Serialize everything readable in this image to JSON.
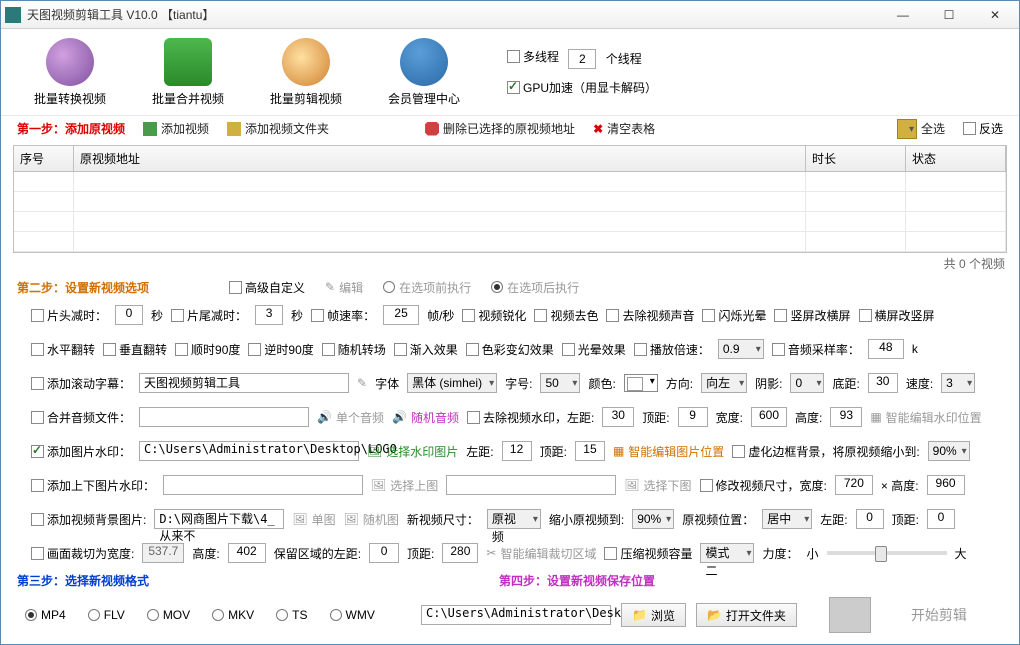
{
  "title": "天图视频剪辑工具 V10.0 【tiantu】",
  "win": {
    "min": "—",
    "max": "☐",
    "close": "✕"
  },
  "toolbar": {
    "t1": "批量转换视频",
    "t2": "批量合并视频",
    "t3": "批量剪辑视频",
    "t4": "会员管理中心",
    "multi": "多线程",
    "threads": "2",
    "threadsuf": "个线程",
    "gpu": "GPU加速（用显卡解码）"
  },
  "s1": {
    "title": "第一步：添加原视频",
    "add": "添加视频",
    "addf": "添加视频文件夹",
    "del": "删除已选择的原视频地址",
    "clear": "清空表格",
    "selall": "全选",
    "invsel": "反选"
  },
  "table": {
    "c1": "序号",
    "c2": "原视频地址",
    "c3": "时长",
    "c4": "状态"
  },
  "count": "共 0 个视频",
  "s2": {
    "title": "第二步：设置新视频选项",
    "adv": "高级自定义",
    "edit": "编辑",
    "before": "在选项前执行",
    "after": "在选项后执行"
  },
  "o": {
    "head": "片头减时：",
    "headv": "0",
    "sec": "秒",
    "tail": "片尾减时：",
    "tailv": "3",
    "fps": "帧速率：",
    "fpsv": "25",
    "fpsu": "帧/秒",
    "sharp": "视频锐化",
    "gray": "视频去色",
    "mute": "去除视频声音",
    "flash": "闪烁光晕",
    "v2h": "竖屏改横屏",
    "h2v": "横屏改竖屏",
    "hflip": "水平翻转",
    "vflip": "垂直翻转",
    "cw90": "顺时90度",
    "ccw90": "逆时90度",
    "rtrans": "随机转场",
    "fadein": "渐入效果",
    "colorfx": "色彩变幻效果",
    "halo": "光晕效果",
    "speed": "播放倍速：",
    "speedv": "0.9",
    "asr": "音频采样率：",
    "asrv": "48",
    "asru": "k",
    "subt": "添加滚动字幕：",
    "subtv": "天图视频剪辑工具",
    "font": "字体",
    "fontv": "黑体 (simhei)",
    "size": "字号:",
    "sizev": "50",
    "color": "颜色:",
    "dir": "方向:",
    "dirv": "向左",
    "shadow": "阴影:",
    "shadowv": "0",
    "bottom": "底距:",
    "bottomv": "30",
    "subspeed": "速度:",
    "subspeedv": "3",
    "mergea": "合并音频文件：",
    "singlea": "单个音频",
    "randa": "随机音频",
    "rmwm": "去除视频水印，左距:",
    "rmwmlv": "30",
    "top": "顶距:",
    "rmwmtv": "9",
    "w": "宽度:",
    "rmwmwv": "600",
    "h": "高度:",
    "rmwmhv": "93",
    "smartwm": "智能编辑水印位置",
    "addimg": "添加图片水印：",
    "addimgv": "C:\\Users\\Administrator\\Desktop\\LOGO",
    "selimg": "选择水印图片",
    "imglv": "12",
    "imgtv": "15",
    "smartimg": "智能编辑图片位置",
    "blur": "虚化边框背景，将原视频缩小到:",
    "blurv": "90%",
    "addtb": "添加上下图片水印：",
    "seltop": "选择上图",
    "selbot": "选择下图",
    "resize": "修改视频尺寸，宽度:",
    "rw": "720",
    "x": "× 高度:",
    "rh": "960",
    "bgimg": "添加视频背景图片:",
    "bgimgv": "D:\\网商图片下载\\4_从来不",
    "single": "单图",
    "rand": "随机图",
    "newsize": "新视频尺寸：",
    "newsizev": "原视频",
    "shrink": "缩小原视频到:",
    "shrinkv": "90%",
    "pos": "原视频位置：",
    "posv": "居中",
    "left": "左距:",
    "leftv": "0",
    "topv": "0",
    "crop": "画面裁切为宽度:",
    "cropwv": "537.7",
    "crophv": "402",
    "keepl": "保留区域的左距:",
    "keeplv": "0",
    "keeptv": "280",
    "smartcrop": "智能编辑裁切区域",
    "compress": "压缩视频容量",
    "mode": "模式二",
    "strength": "力度：",
    "small": "小",
    "big": "大"
  },
  "s3": {
    "title": "第三步：选择新视频格式"
  },
  "fmt": {
    "mp4": "MP4",
    "flv": "FLV",
    "mov": "MOV",
    "mkv": "MKV",
    "ts": "TS",
    "wmv": "WMV"
  },
  "s4": {
    "title": "第四步：设置新视频保存位置",
    "path": "C:\\Users\\Administrator\\Desktop",
    "browse": "浏览",
    "open": "打开文件夹",
    "start": "开始剪辑"
  }
}
